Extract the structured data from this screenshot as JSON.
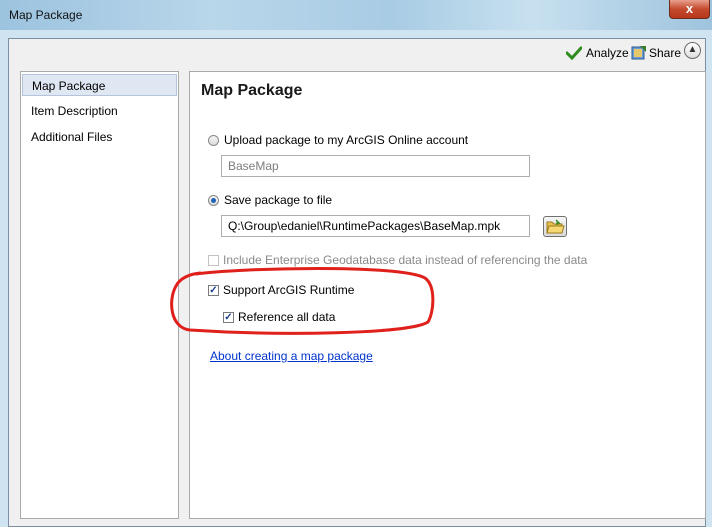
{
  "window": {
    "title": "Map Package",
    "close_label": "x"
  },
  "toolbar": {
    "analyze_label": "Analyze",
    "share_label": "Share",
    "analyze_icon": "checkmark-icon",
    "share_icon": "share-icon",
    "collapse_icon": "chevron-up-icon"
  },
  "sidebar": {
    "items": [
      {
        "label": "Map Package",
        "selected": true
      },
      {
        "label": "Item Description",
        "selected": false
      },
      {
        "label": "Additional Files",
        "selected": false
      }
    ]
  },
  "main": {
    "title": "Map Package",
    "upload_option": {
      "label": "Upload package to my ArcGIS Online account",
      "selected": false
    },
    "upload_field": {
      "value": "BaseMap",
      "enabled": false
    },
    "save_option": {
      "label": "Save package to file",
      "selected": true
    },
    "save_path": {
      "value": "Q:\\Group\\edaniel\\RuntimePackages\\BaseMap.mpk"
    },
    "enterprise_checkbox": {
      "label": "Include Enterprise Geodatabase data instead of referencing the data",
      "checked": false,
      "enabled": false
    },
    "runtime_checkbox": {
      "label": "Support ArcGIS Runtime",
      "checked": true
    },
    "reference_checkbox": {
      "label": "Reference all data",
      "checked": true
    },
    "help_link": "About creating a map package"
  },
  "annotation": {
    "highlight_color": "#e0201b"
  }
}
